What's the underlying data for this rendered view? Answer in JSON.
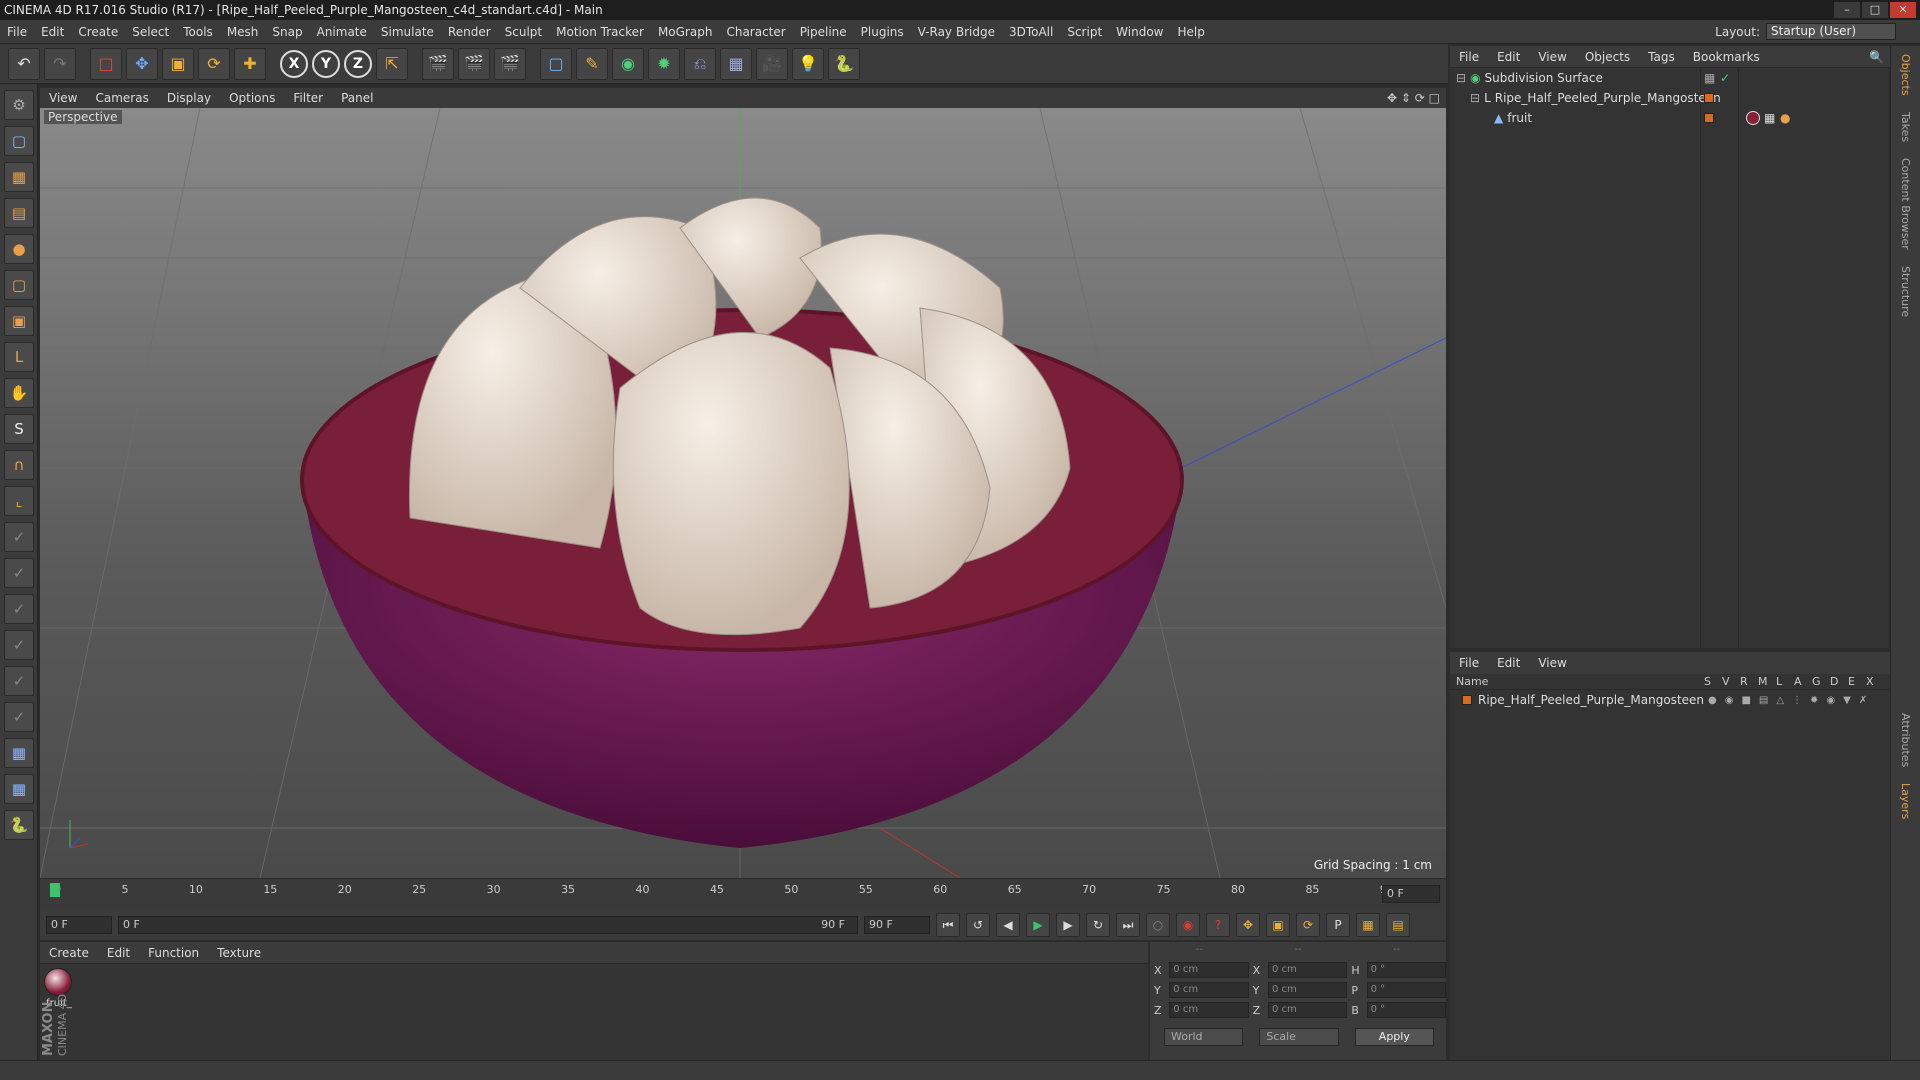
{
  "window": {
    "title": "CINEMA 4D R17.016 Studio (R17) - [Ripe_Half_Peeled_Purple_Mangosteen_c4d_standart.c4d] - Main"
  },
  "menubar": {
    "items": [
      "File",
      "Edit",
      "Create",
      "Select",
      "Tools",
      "Mesh",
      "Snap",
      "Animate",
      "Simulate",
      "Render",
      "Sculpt",
      "Motion Tracker",
      "MoGraph",
      "Character",
      "Pipeline",
      "Plugins",
      "V-Ray Bridge",
      "3DToAll",
      "Script",
      "Window",
      "Help"
    ],
    "layout_label": "Layout:",
    "layout_value": "Startup (User)"
  },
  "viewport": {
    "menu": [
      "View",
      "Cameras",
      "Display",
      "Options",
      "Filter",
      "Panel"
    ],
    "camera_label": "Perspective",
    "grid_spacing": "Grid Spacing : 1 cm"
  },
  "timeline": {
    "ticks": [
      "0",
      "5",
      "10",
      "15",
      "20",
      "25",
      "30",
      "35",
      "40",
      "45",
      "50",
      "55",
      "60",
      "65",
      "70",
      "75",
      "80",
      "85",
      "90"
    ],
    "end_field": "0 F"
  },
  "transport": {
    "current_frame": "0 F",
    "range_start": "0 F",
    "range_end_inner": "90 F",
    "range_end": "90 F"
  },
  "materials": {
    "menu": [
      "Create",
      "Edit",
      "Function",
      "Texture"
    ],
    "items": [
      {
        "name": "fruit_"
      }
    ]
  },
  "coordinates": {
    "header": [
      "--",
      "--",
      "--"
    ],
    "rows": [
      {
        "a_label": "X",
        "a_val": "0 cm",
        "b_label": "X",
        "b_val": "0 cm",
        "c_label": "H",
        "c_val": "0 °"
      },
      {
        "a_label": "Y",
        "a_val": "0 cm",
        "b_label": "Y",
        "b_val": "0 cm",
        "c_label": "P",
        "c_val": "0 °"
      },
      {
        "a_label": "Z",
        "a_val": "0 cm",
        "b_label": "Z",
        "b_val": "0 cm",
        "c_label": "B",
        "c_val": "0 °"
      }
    ],
    "mode_world": "World",
    "mode_scale": "Scale",
    "apply": "Apply"
  },
  "object_manager": {
    "menu": [
      "File",
      "Edit",
      "View",
      "Objects",
      "Tags",
      "Bookmarks"
    ],
    "objects": [
      {
        "name": "Subdivision Surface"
      },
      {
        "name": "Ripe_Half_Peeled_Purple_Mangosteen"
      },
      {
        "name": "fruit"
      }
    ]
  },
  "layer_manager": {
    "menu": [
      "File",
      "Edit",
      "View"
    ],
    "columns": [
      "Name",
      "S",
      "V",
      "R",
      "M",
      "L",
      "A",
      "G",
      "D",
      "E",
      "X"
    ],
    "layers": [
      {
        "name": "Ripe_Half_Peeled_Purple_Mangosteen"
      }
    ]
  },
  "side_tabs": [
    "Objects",
    "Takes",
    "Content Browser",
    "Structure",
    "Attributes",
    "Layers"
  ],
  "brand": {
    "maxon": "MAXON",
    "product": "CINEMA 4D"
  },
  "colors": {
    "accent_orange": "#d96a22",
    "background": "#3b3b3b"
  }
}
